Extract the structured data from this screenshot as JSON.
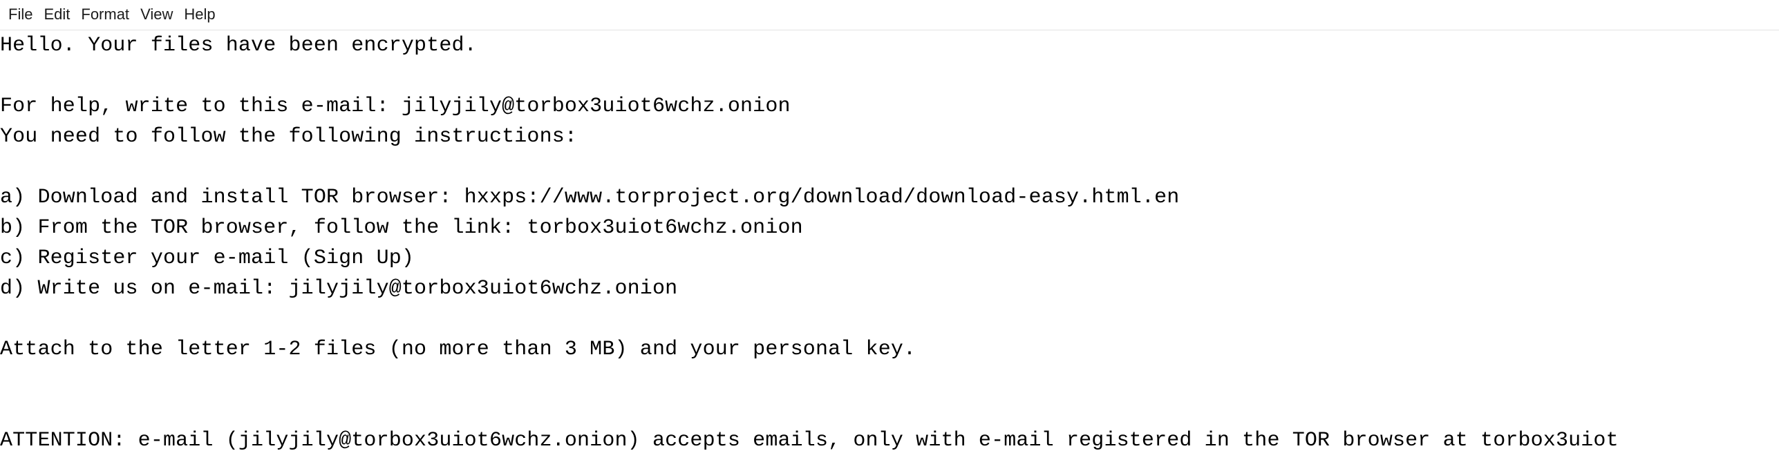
{
  "window": {
    "app_name": "Notepad",
    "background_color": "#ffffff",
    "text_color": "#000000",
    "menubar_border_color": "#e3e3e3"
  },
  "menubar": {
    "items": [
      {
        "label": "File"
      },
      {
        "label": "Edit"
      },
      {
        "label": "Format"
      },
      {
        "label": "View"
      },
      {
        "label": "Help"
      }
    ]
  },
  "document": {
    "contact_email": "jilyjily@torbox3uiot6wchz.onion",
    "onion_link": "torbox3uiot6wchz.onion",
    "tor_download_url": "hxxps://www.torproject.org/download/download-easy.html.en",
    "lines": [
      "Hello. Your files have been encrypted.",
      "",
      "For help, write to this e-mail: jilyjily@torbox3uiot6wchz.onion",
      "You need to follow the following instructions:",
      "",
      "a) Download and install TOR browser: hxxps://www.torproject.org/download/download-easy.html.en",
      "b) From the TOR browser, follow the link: torbox3uiot6wchz.onion",
      "c) Register your e-mail (Sign Up)",
      "d) Write us on e-mail: jilyjily@torbox3uiot6wchz.onion",
      "",
      "Attach to the letter 1-2 files (no more than 3 MB) and your personal key.",
      "",
      "",
      "ATTENTION: e-mail (jilyjily@torbox3uiot6wchz.onion) accepts emails, only with e-mail registered in the TOR browser at torbox3uiot"
    ]
  }
}
